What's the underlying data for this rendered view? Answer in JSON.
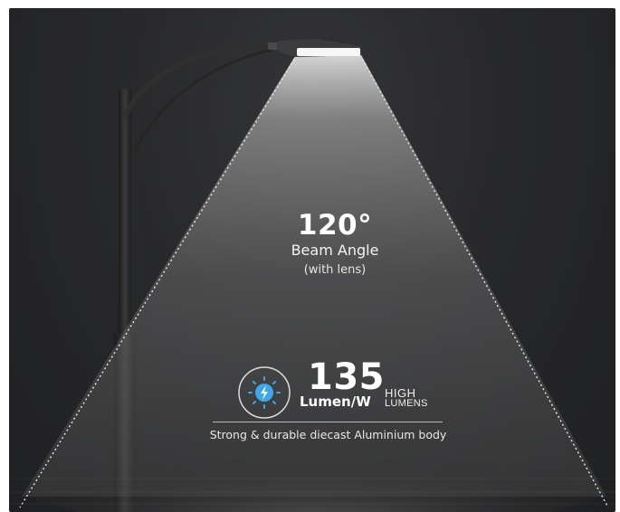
{
  "beam": {
    "value": "120°",
    "label": "Beam Angle",
    "note": "(with lens)"
  },
  "efficiency": {
    "value": "135",
    "unit": "Lumen/W",
    "badge_top": "HIGH",
    "badge_bottom": "LUMENS",
    "icon": "lightning-bulb-icon"
  },
  "body_text": "Strong & durable diecast Aluminium body",
  "colors": {
    "background": "#2a2b2c",
    "accent": "#3fa8e8",
    "text": "#ffffff"
  }
}
